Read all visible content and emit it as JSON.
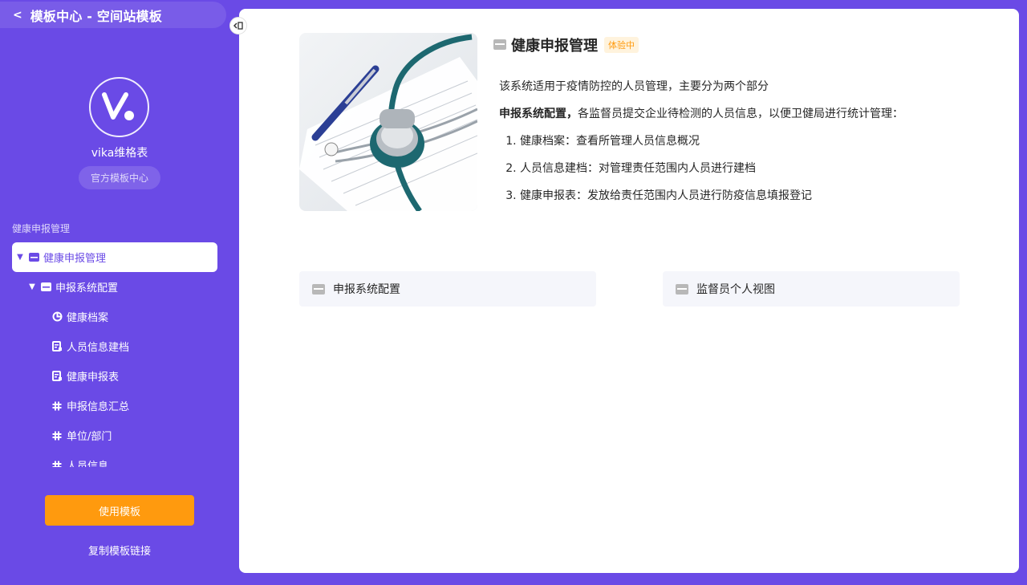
{
  "topbar": {
    "back_icon": "chevron-left-icon",
    "title": "模板中心 - 空间站模板"
  },
  "brand": {
    "name": "vika维格表",
    "badge": "官方模板中心"
  },
  "sidebar": {
    "section_label": "健康申报管理",
    "tree": [
      {
        "label": "健康申报管理",
        "icon": "folder-icon",
        "expanded": true,
        "selected": true
      },
      {
        "label": "申报系统配置",
        "icon": "folder-icon",
        "expanded": true
      },
      {
        "label": "健康档案",
        "icon": "dashboard-icon"
      },
      {
        "label": "人员信息建档",
        "icon": "form-icon"
      },
      {
        "label": "健康申报表",
        "icon": "form-icon"
      },
      {
        "label": "申报信息汇总",
        "icon": "datasheet-icon"
      },
      {
        "label": "单位/部门",
        "icon": "datasheet-icon"
      },
      {
        "label": "人员信息",
        "icon": "datasheet-icon"
      }
    ],
    "use_button": "使用模板",
    "copy_link": "复制模板链接"
  },
  "main": {
    "title": "健康申报管理",
    "tag": "体验中",
    "intro": "该系统适用于疫情防控的人员管理，主要分为两个部分",
    "bold_lead": "申报系统配置，",
    "bold_rest": "各监督员提交企业待检测的人员信息，以便卫健局进行统计管理：",
    "items": [
      "健康档案：查看所管理人员信息概况",
      "人员信息建档：对管理责任范围内人员进行建档",
      "健康申报表：发放给责任范围内人员进行防疫信息填报登记"
    ],
    "cards": [
      "申报系统配置",
      "监督员个人视图"
    ]
  },
  "colors": {
    "brand": "#6a4ae6",
    "accent": "#ff9a0e",
    "tag_bg": "#fff3dd",
    "card_bg": "#f5f6fb"
  }
}
